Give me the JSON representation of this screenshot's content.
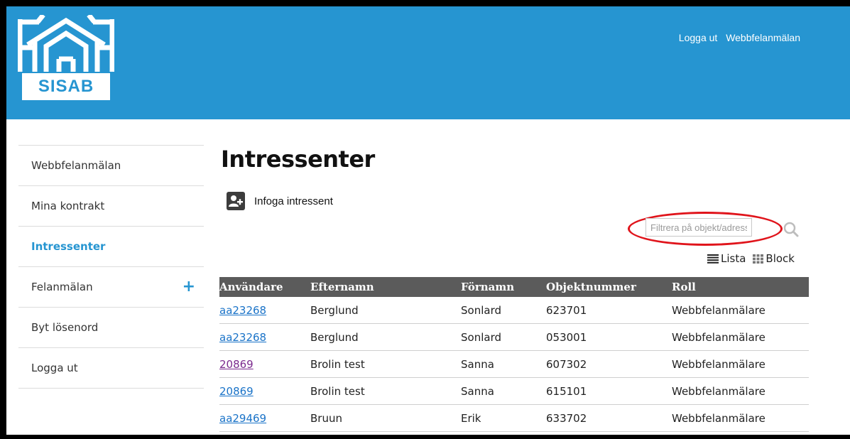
{
  "header": {
    "logo_text": "SISAB",
    "links": [
      "Logga ut",
      "Webbfelanmälan"
    ]
  },
  "sidebar": {
    "items": [
      {
        "label": "Webbfelanmälan"
      },
      {
        "label": "Mina kontrakt"
      },
      {
        "label": "Intressenter",
        "active": true
      },
      {
        "label": "Felanmälan",
        "expand_icon": "plus-icon"
      },
      {
        "label": "Byt lösenord"
      },
      {
        "label": "Logga ut"
      }
    ]
  },
  "main": {
    "title": "Intressenter",
    "add_button_label": "Infoga intressent",
    "filter": {
      "placeholder": "Filtrera på objekt/adress",
      "value": ""
    },
    "view_toggle": {
      "list_label": "Lista",
      "block_label": "Block"
    },
    "table": {
      "columns": [
        "Användare",
        "Efternamn",
        "Förnamn",
        "Objektnummer",
        "Roll"
      ],
      "rows": [
        [
          "aa23268",
          "Berglund",
          "Sonlard",
          "623701",
          "Webbfelanmälare"
        ],
        [
          "aa23268",
          "Berglund",
          "Sonlard",
          "053001",
          "Webbfelanmälare"
        ],
        [
          "20869",
          "Brolin test",
          "Sanna",
          "607302",
          "Webbfelanmälare"
        ],
        [
          "20869",
          "Brolin test",
          "Sanna",
          "615101",
          "Webbfelanmälare"
        ],
        [
          "aa29469",
          "Bruun",
          "Erik",
          "633702",
          "Webbfelanmälare"
        ]
      ]
    }
  },
  "colors": {
    "header_bg": "#2695d1",
    "accent": "#2695d1",
    "table_header_bg": "#5b5b5b",
    "link": "#1a73c8",
    "visited_link": "#7b2a8e",
    "highlight": "#e0141b"
  }
}
